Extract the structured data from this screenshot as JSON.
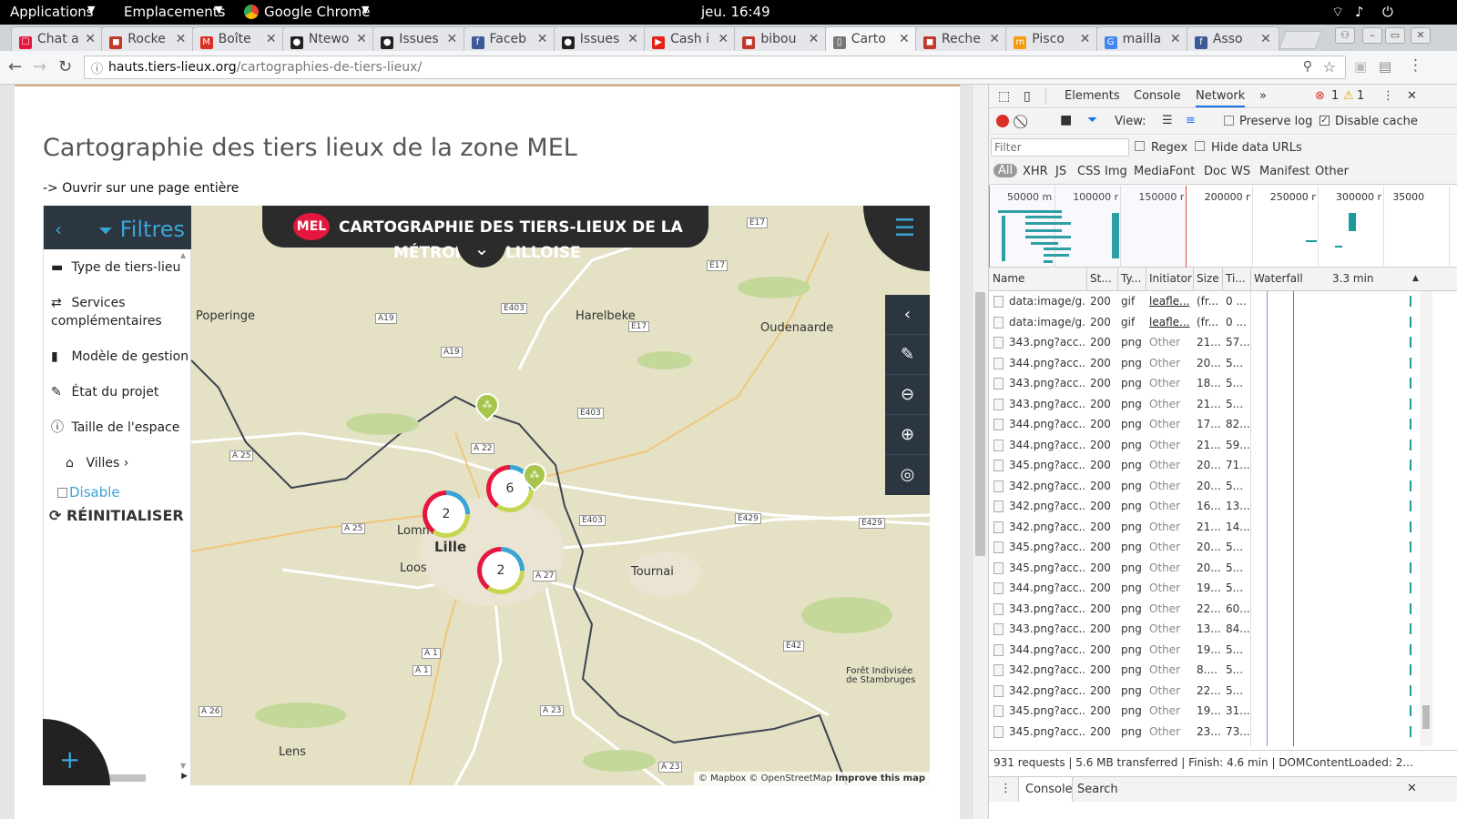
{
  "system": {
    "applications": "Applications",
    "places": "Emplacements",
    "app": "Google Chrome",
    "clock": "jeu. 16:49"
  },
  "tabs": [
    {
      "label": "Chat a",
      "color": "#e5173f",
      "glyph": "☐"
    },
    {
      "label": "Rocke",
      "color": "#c0392b",
      "glyph": "◼"
    },
    {
      "label": "Boîte",
      "color": "#d93025",
      "glyph": "M"
    },
    {
      "label": "Ntewo",
      "color": "#222222",
      "glyph": "●"
    },
    {
      "label": "Issues",
      "color": "#222222",
      "glyph": "●"
    },
    {
      "label": "Faceb",
      "color": "#3b5998",
      "glyph": "f"
    },
    {
      "label": "Issues",
      "color": "#222222",
      "glyph": "●"
    },
    {
      "label": "Cash i",
      "color": "#e62117",
      "glyph": "▶"
    },
    {
      "label": "bibou",
      "color": "#c0392b",
      "glyph": "◼"
    },
    {
      "label": "Carto",
      "color": "#777777",
      "glyph": "▯"
    },
    {
      "label": "Reche",
      "color": "#c0392b",
      "glyph": "◼"
    },
    {
      "label": "Pisco",
      "color": "#f39c12",
      "glyph": "m"
    },
    {
      "label": "mailla",
      "color": "#4285f4",
      "glyph": "G"
    },
    {
      "label": "Asso",
      "color": "#3b5998",
      "glyph": "f"
    }
  ],
  "address": {
    "host": "hauts.tiers-lieux.org",
    "path": "/cartographies-de-tiers-lieux/"
  },
  "page": {
    "title": "Cartographie des tiers lieux de la zone MEL",
    "open_link": "-> Ouvrir sur une page entière"
  },
  "filters": {
    "title": "Filtres",
    "items": [
      {
        "icon": "▬",
        "label": "Type de tiers-lieu"
      },
      {
        "icon": "⇄",
        "label": "Services"
      },
      {
        "icon": "",
        "label": "complémentaires"
      },
      {
        "icon": "▮",
        "label": "Modèle de gestion"
      },
      {
        "icon": "✎",
        "label": "État du projet"
      },
      {
        "icon": "ⓘ",
        "label": "Taille de l'espace"
      },
      {
        "icon": "⌂",
        "label": "Villes ›"
      }
    ],
    "disable": "Disable",
    "reset": "⟳ RÉINITIALISER",
    "plus": "+"
  },
  "map": {
    "logo": "MEL",
    "banner": "CARTOGRAPHIE DES TIERS-LIEUX DE LA",
    "banner2": "MÉTROPOLE LILLOISE",
    "places": [
      "Poperinge",
      "Harelbeke",
      "Oudenaarde",
      "Lomme",
      "Lille",
      "Loos",
      "Tournai",
      "Lens",
      "Forêt Indivisée",
      "de Stambruges"
    ],
    "roads": [
      "E17",
      "E17",
      "A19",
      "E403",
      "A19",
      "E17",
      "E403",
      "A 22",
      "A 25",
      "A 25",
      "E403",
      "E429",
      "E429",
      "A 27",
      "A 1",
      "A 1",
      "E42",
      "A 26",
      "A 23",
      "A 23"
    ],
    "clusters": [
      "2",
      "6",
      "2"
    ],
    "attribution": "© Mapbox © OpenStreetMap",
    "improve": "Improve this map"
  },
  "devtools": {
    "tabs": [
      "Elements",
      "Console",
      "Network"
    ],
    "errors": "1",
    "warnings": "1",
    "view": "View:",
    "preserve": "Preserve log",
    "disable_cache": "Disable cache",
    "filter_placeholder": "Filter",
    "regex": "Regex",
    "hide_data": "Hide data URLs",
    "types": [
      "All",
      "XHR",
      "JS",
      "CSS",
      "Img",
      "Media",
      "Font",
      "Doc",
      "WS",
      "Manifest",
      "Other"
    ],
    "ticks": [
      "50000 ms",
      "100000 ms",
      "150000 ms",
      "200000 ms",
      "250000 ms",
      "300000 ms",
      "35000"
    ],
    "columns": [
      "Name",
      "St...",
      "Ty...",
      "Initiator",
      "Size",
      "Ti...",
      "Waterfall",
      "3.3 min"
    ],
    "rows": [
      [
        "data:image/g...",
        "200",
        "gif",
        "leafle...",
        "(fr...",
        "0 ..."
      ],
      [
        "data:image/g...",
        "200",
        "gif",
        "leafle...",
        "(fr...",
        "0 ..."
      ],
      [
        "343.png?acc...",
        "200",
        "png",
        "Other",
        "21...",
        "57..."
      ],
      [
        "344.png?acc...",
        "200",
        "png",
        "Other",
        "20...",
        "5..."
      ],
      [
        "343.png?acc...",
        "200",
        "png",
        "Other",
        "18...",
        "5..."
      ],
      [
        "343.png?acc...",
        "200",
        "png",
        "Other",
        "21...",
        "5..."
      ],
      [
        "344.png?acc...",
        "200",
        "png",
        "Other",
        "17...",
        "82..."
      ],
      [
        "344.png?acc...",
        "200",
        "png",
        "Other",
        "21...",
        "59..."
      ],
      [
        "345.png?acc...",
        "200",
        "png",
        "Other",
        "20...",
        "71..."
      ],
      [
        "342.png?acc...",
        "200",
        "png",
        "Other",
        "20...",
        "5..."
      ],
      [
        "342.png?acc...",
        "200",
        "png",
        "Other",
        "16...",
        "13..."
      ],
      [
        "342.png?acc...",
        "200",
        "png",
        "Other",
        "21...",
        "14..."
      ],
      [
        "345.png?acc...",
        "200",
        "png",
        "Other",
        "20...",
        "5..."
      ],
      [
        "345.png?acc...",
        "200",
        "png",
        "Other",
        "20...",
        "5..."
      ],
      [
        "344.png?acc...",
        "200",
        "png",
        "Other",
        "19...",
        "5..."
      ],
      [
        "343.png?acc...",
        "200",
        "png",
        "Other",
        "22...",
        "60..."
      ],
      [
        "343.png?acc...",
        "200",
        "png",
        "Other",
        "13...",
        "84..."
      ],
      [
        "344.png?acc...",
        "200",
        "png",
        "Other",
        "19...",
        "5..."
      ],
      [
        "342.png?acc...",
        "200",
        "png",
        "Other",
        "8....",
        "5..."
      ],
      [
        "342.png?acc...",
        "200",
        "png",
        "Other",
        "22...",
        "5..."
      ],
      [
        "345.png?acc...",
        "200",
        "png",
        "Other",
        "19...",
        "31..."
      ],
      [
        "345.png?acc...",
        "200",
        "png",
        "Other",
        "23...",
        "73..."
      ]
    ],
    "status": "931 requests  |  5.6 MB transferred  |  Finish: 4.6 min  |  DOMContentLoaded: 2...",
    "drawer": [
      "Console",
      "Search"
    ]
  },
  "colors": {
    "accent": "#3aa4d6",
    "mel_red": "#e5173f",
    "dark": "#2b3640"
  }
}
